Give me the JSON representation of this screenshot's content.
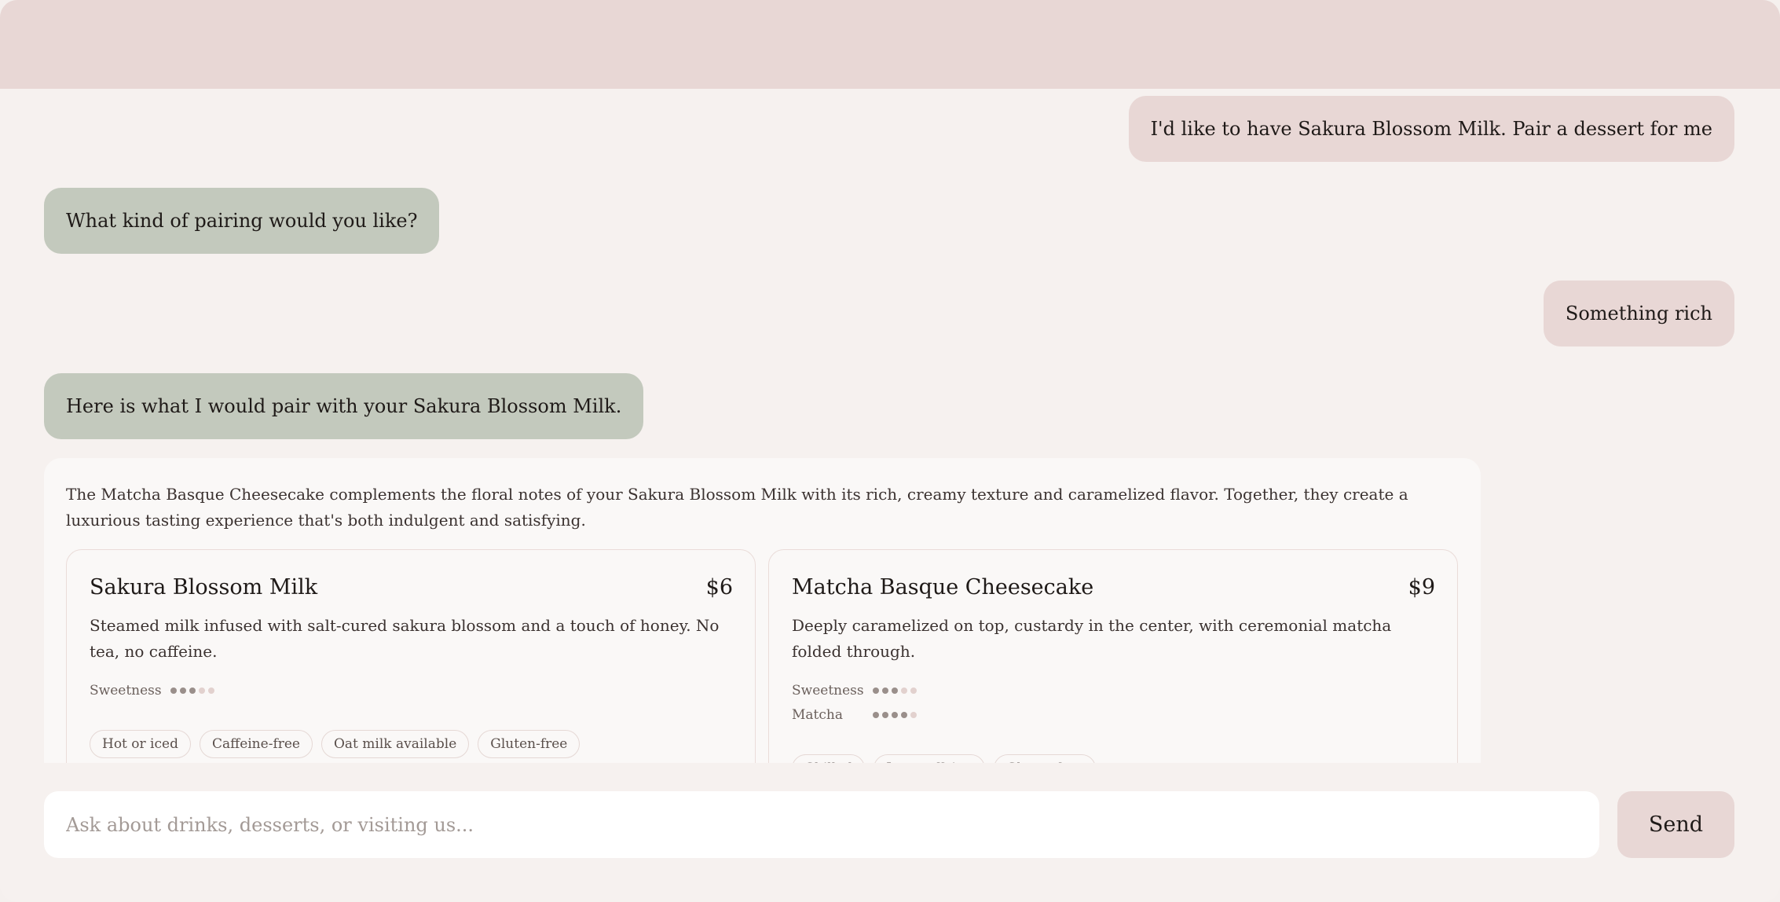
{
  "messages": [
    {
      "role": "user",
      "text": "I'd like to have Sakura Blossom Milk. Pair a dessert for me"
    },
    {
      "role": "assistant",
      "text": "What kind of pairing would you like?"
    },
    {
      "role": "user",
      "text": "Something rich"
    },
    {
      "role": "assistant",
      "text": "Here is what I would pair with your Sakura Blossom Milk."
    }
  ],
  "recommendation": {
    "intro": "The Matcha Basque Cheesecake complements the floral notes of your Sakura Blossom Milk with its rich, creamy texture and caramelized flavor. Together, they create a luxurious tasting experience that's both indulgent and satisfying.",
    "items": [
      {
        "name": "Sakura Blossom Milk",
        "price": "$6",
        "description": "Steamed milk infused with salt-cured sakura blossom and a touch of honey. No tea, no caffeine.",
        "meters": [
          {
            "label": "Sweetness",
            "level": 3,
            "max": 5
          }
        ],
        "tags": [
          "Hot or iced",
          "Caffeine-free",
          "Oat milk available",
          "Gluten-free"
        ]
      },
      {
        "name": "Matcha Basque Cheesecake",
        "price": "$9",
        "description": "Deeply caramelized on top, custardy in the center, with ceremonial matcha folded through.",
        "meters": [
          {
            "label": "Sweetness",
            "level": 3,
            "max": 5
          },
          {
            "label": "Matcha",
            "level": 4,
            "max": 5
          }
        ],
        "tags": [
          "Chilled",
          "Low caffeine",
          "Gluten-free"
        ]
      }
    ]
  },
  "composer": {
    "placeholder": "Ask about drinks, desserts, or visiting us...",
    "send_label": "Send"
  },
  "colors": {
    "background": "#f6f1ef",
    "header": "#e8d7d5",
    "user_bubble": "#e8d7d5",
    "assistant_bubble": "#c3c9bd",
    "dot_filled": "#9a8f8b",
    "dot_empty": "#e2d1ce"
  }
}
